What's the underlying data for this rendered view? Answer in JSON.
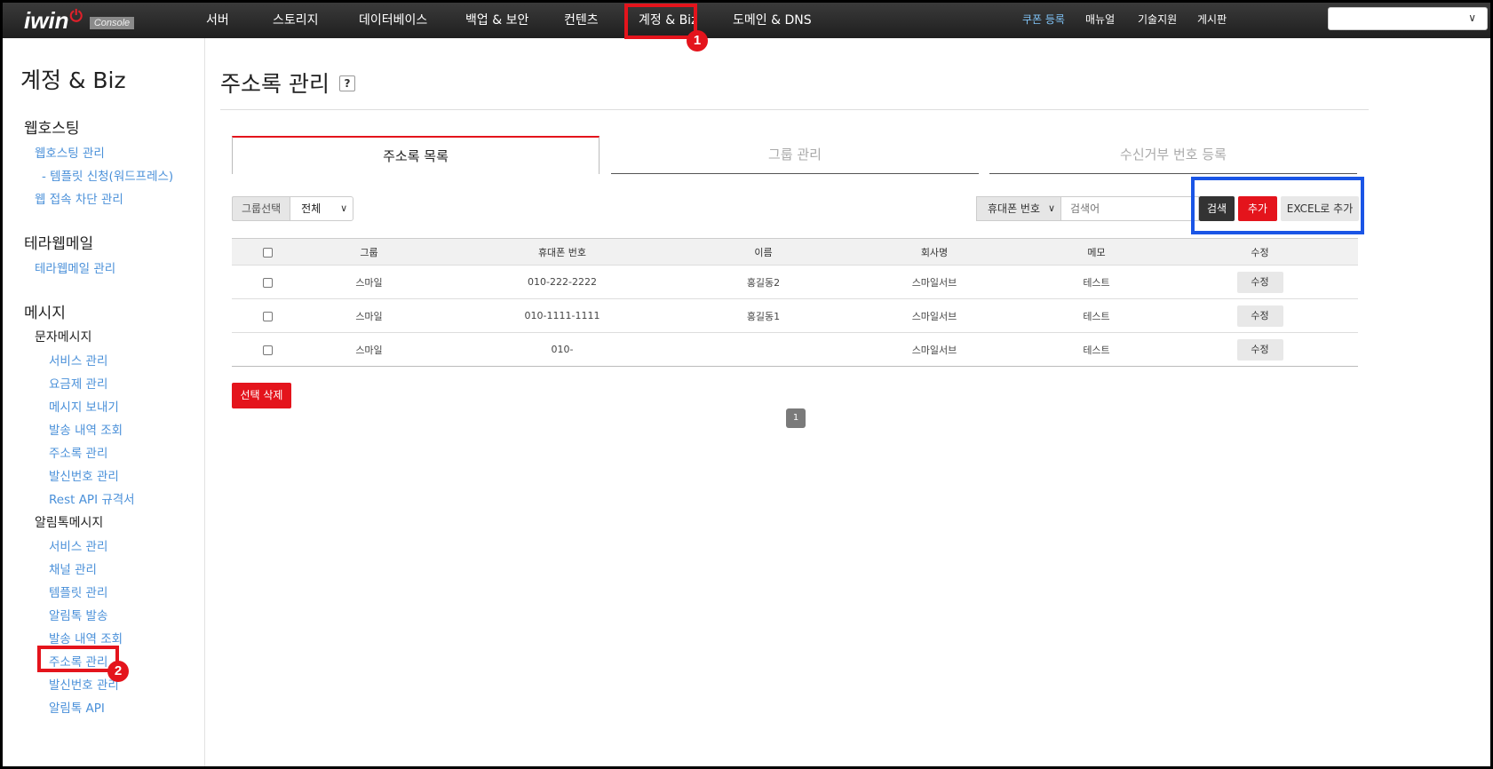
{
  "logo": {
    "brand": "iwin",
    "badge": "Console"
  },
  "topnav": {
    "menu": [
      {
        "label": "서버"
      },
      {
        "label": "스토리지"
      },
      {
        "label": "데이터베이스"
      },
      {
        "label": "백업 & 보안"
      },
      {
        "label": "컨텐츠"
      },
      {
        "label": "계정 & Biz"
      },
      {
        "label": "도메인 & DNS"
      }
    ],
    "utils": [
      {
        "label": "쿠폰 등록"
      },
      {
        "label": "매뉴얼"
      },
      {
        "label": "기술지원"
      },
      {
        "label": "게시판"
      }
    ],
    "select_value": ""
  },
  "annotations": {
    "step1": "1",
    "step2": "2"
  },
  "sidebar": {
    "title": "계정 & Biz",
    "sections": {
      "webhosting": {
        "heading": "웹호스팅",
        "links": [
          "웹호스팅 관리",
          "- 템플릿 신청(워드프레스)",
          "웹 접속 차단 관리"
        ]
      },
      "terramail": {
        "heading": "테라웹메일",
        "links": [
          "테라웹메일 관리"
        ]
      },
      "message": {
        "heading": "메시지",
        "sms": {
          "label": "문자메시지",
          "links": [
            "서비스 관리",
            "요금제 관리",
            "메시지 보내기",
            "발송 내역 조회",
            "주소록 관리",
            "발신번호 관리",
            "Rest API 규격서"
          ]
        },
        "alimtalk": {
          "label": "알림톡메시지",
          "links": [
            "서비스 관리",
            "채널 관리",
            "템플릿 관리",
            "알림톡 발송",
            "발송 내역 조회",
            "주소록 관리",
            "발신번호 관리",
            "알림톡 API"
          ]
        }
      }
    }
  },
  "main": {
    "title": "주소록 관리",
    "help": "?",
    "tabs": [
      "주소록 목록",
      "그룹 관리",
      "수신거부 번호 등록"
    ],
    "group_filter": {
      "label": "그룹선택",
      "value": "전체"
    },
    "search": {
      "field": "휴대폰 번호",
      "placeholder": "검색어",
      "search_label": "검색",
      "add_label": "추가",
      "excel_label": "EXCEL로 추가"
    },
    "table": {
      "headers": [
        "그룹",
        "휴대폰 번호",
        "이름",
        "회사명",
        "메모",
        "수정"
      ],
      "rows": [
        {
          "group": "스마일",
          "phone": "010-222-2222",
          "name": "홍길동2",
          "company": "스마일서브",
          "memo": "테스트",
          "edit": "수정"
        },
        {
          "group": "스마일",
          "phone": "010-1111-1111",
          "name": "홍길동1",
          "company": "스마일서브",
          "memo": "테스트",
          "edit": "수정"
        },
        {
          "group": "스마일",
          "phone": "010-",
          "name": "",
          "company": "스마일서브",
          "memo": "테스트",
          "edit": "수정"
        }
      ]
    },
    "delete_label": "선택 삭제",
    "pagination": {
      "current": "1"
    }
  }
}
